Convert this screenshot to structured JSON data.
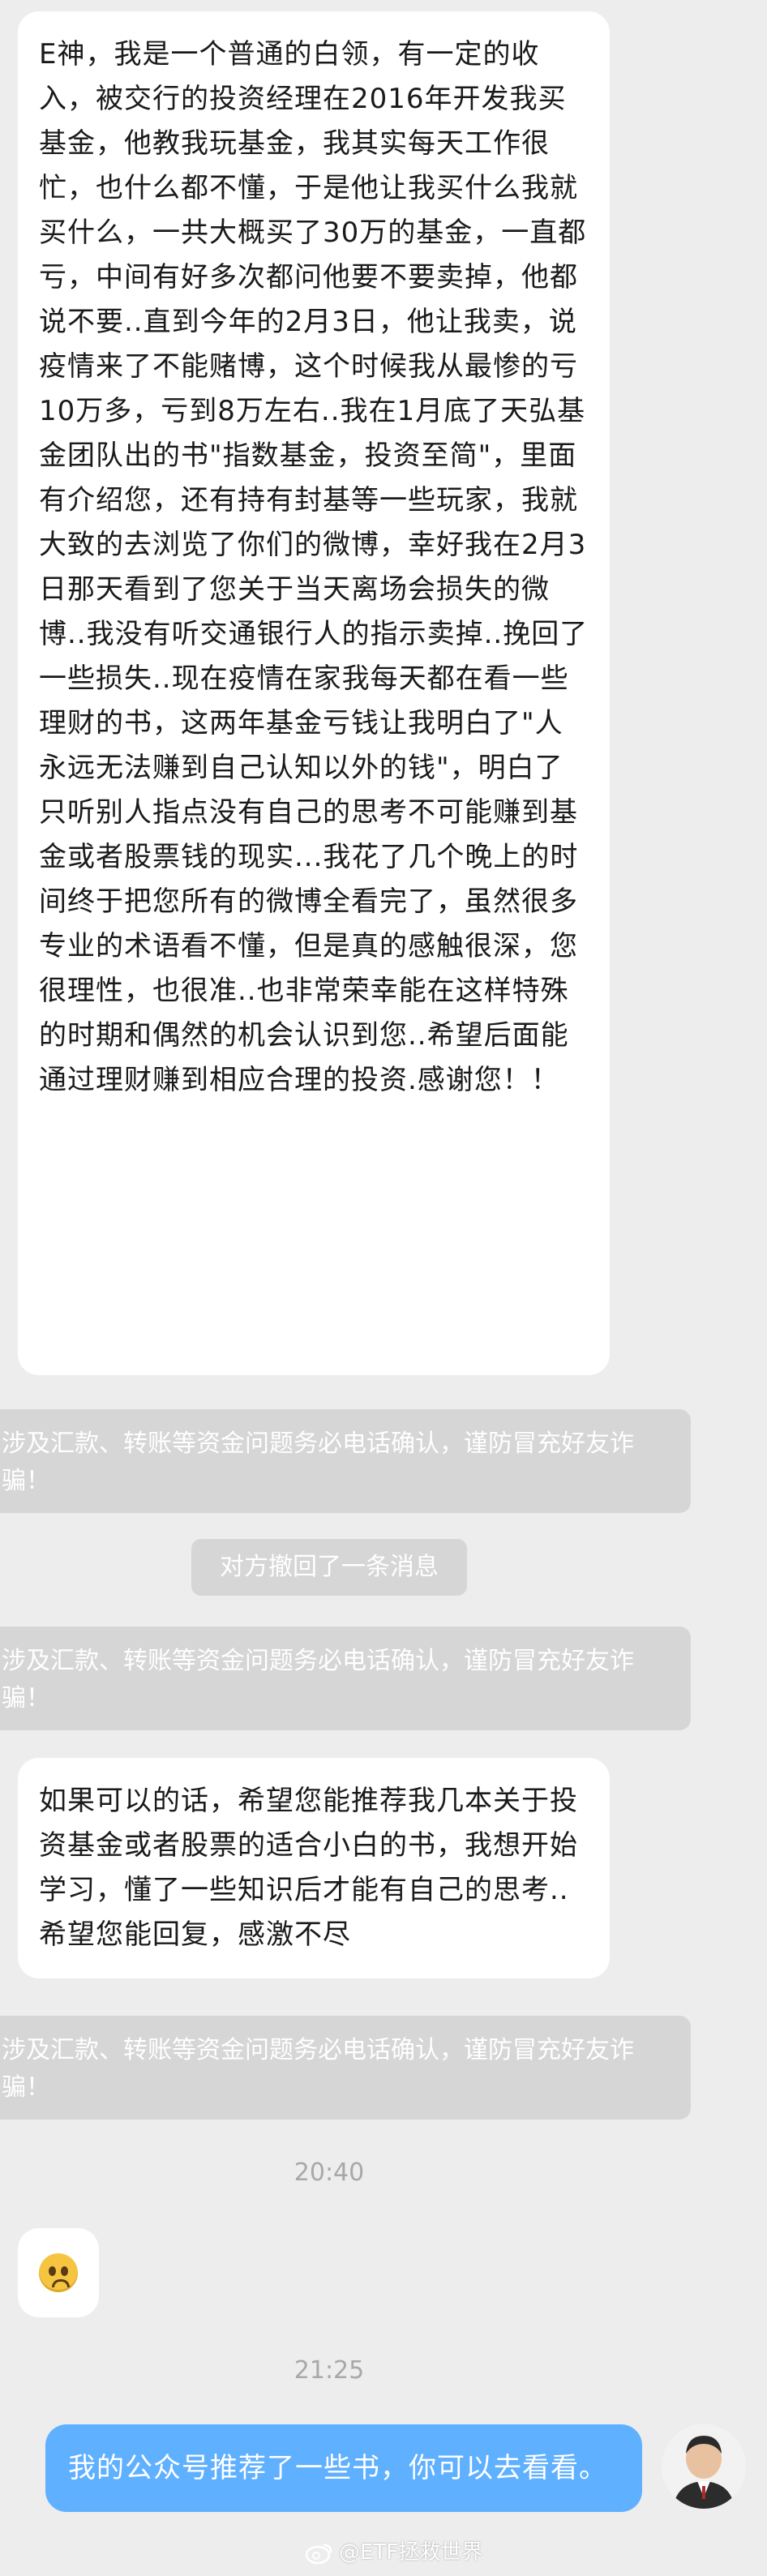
{
  "messages": {
    "msg1": "E神，我是一个普通的白领，有一定的收入，被交行的投资经理在2016年开发我买基金，他教我玩基金，我其实每天工作很忙，也什么都不懂，于是他让我买什么我就买什么，一共大概买了30万的基金，一直都亏，中间有好多次都问他要不要卖掉，他都说不要..直到今年的2月3日，他让我卖，说疫情来了不能赌博，这个时候我从最惨的亏10万多，亏到8万左右..我在1月底了天弘基金团队出的书\"指数基金，投资至简\"，里面有介绍您，还有持有封基等一些玩家，我就大致的去浏览了你们的微博，幸好我在2月3日那天看到了您关于当天离场会损失的微博..我没有听交通银行人的指示卖掉..挽回了一些损失..现在疫情在家我每天都在看一些理财的书，这两年基金亏钱让我明白了\"人永远无法赚到自己认知以外的钱\"，明白了只听别人指点没有自己的思考不可能赚到基金或者股票钱的现实...我花了几个晚上的时间终于把您所有的微博全看完了，虽然很多专业的术语看不懂，但是真的感触很深，您很理性，也很准..也非常荣幸能在这样特殊的时期和偶然的机会认识到您..希望后面能通过理财赚到相应合理的投资.感谢您！！",
    "warn1": "涉及汇款、转账等资金问题务必电话确认，谨防冒充好友诈骗！",
    "recall": "对方撤回了一条消息",
    "warn2": "涉及汇款、转账等资金问题务必电话确认，谨防冒充好友诈骗！",
    "msg2": "如果可以的话，希望您能推荐我几本关于投资基金或者股票的适合小白的书，我想开始学习，懂了一些知识后才能有自己的思考..希望您能回复，感激不尽",
    "warn3": "涉及汇款、转账等资金问题务必电话确认，谨防冒充好友诈骗！",
    "time1": "20:40",
    "time2": "21:25",
    "reply": "我的公众号推荐了一些书，你可以去看看。"
  },
  "watermark": "@ETF拯救世界",
  "colors": {
    "background": "#ededed",
    "incoming_bubble": "#ffffff",
    "outgoing_bubble": "#5fb0ff",
    "system_notice": "#d6d6d6"
  },
  "icons": {
    "emoji": "pleading-face-icon",
    "avatar": "user-avatar",
    "watermark_logo": "weibo-logo-icon"
  }
}
